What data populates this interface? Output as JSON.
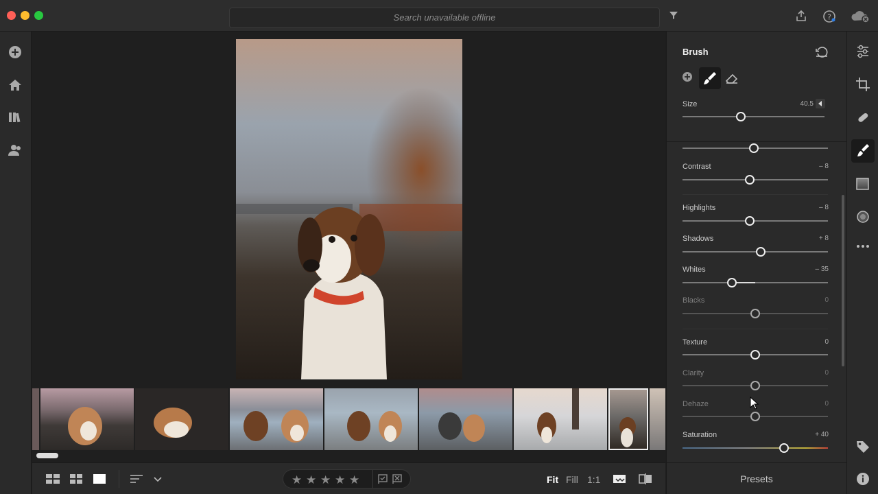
{
  "search": {
    "placeholder": "Search unavailable offline"
  },
  "panel": {
    "title": "Brush",
    "size": {
      "label": "Size",
      "value": "40.5",
      "level": 0.41
    },
    "sliders": [
      {
        "label": "",
        "value": "",
        "level": 0.49,
        "dim": false
      },
      {
        "label": "Contrast",
        "value": "– 8",
        "level": 0.46,
        "dim": false
      },
      {
        "label": "Highlights",
        "value": "– 8",
        "level": 0.46,
        "dim": false
      },
      {
        "label": "Shadows",
        "value": "+ 8",
        "level": 0.54,
        "dim": false
      },
      {
        "label": "Whites",
        "value": "– 35",
        "level": 0.34,
        "dim": false
      },
      {
        "label": "Blacks",
        "value": "0",
        "level": 0.5,
        "dim": true
      },
      {
        "label": "Texture",
        "value": "0",
        "level": 0.5,
        "dim": false
      },
      {
        "label": "Clarity",
        "value": "0",
        "level": 0.5,
        "dim": true
      },
      {
        "label": "Dehaze",
        "value": "0",
        "level": 0.5,
        "dim": true
      },
      {
        "label": "Saturation",
        "value": "+ 40",
        "level": 0.7,
        "dim": false
      }
    ]
  },
  "presets_label": "Presets",
  "zoom": {
    "fit": "Fit",
    "fill": "Fill",
    "one": "1:1"
  },
  "colors": {
    "accent": "#ffffff",
    "panel": "#2a2a2a",
    "canvas": "#1f1f1f"
  },
  "icons": {
    "titlebar": [
      "filter-icon",
      "share-icon",
      "help-icon",
      "cloud-offline-icon"
    ],
    "leftrail": [
      "add-photos-icon",
      "home-icon",
      "library-icon",
      "people-icon"
    ],
    "rightrail": [
      "edit-sliders-icon",
      "crop-icon",
      "healing-icon",
      "brush-icon",
      "linear-gradient-icon",
      "radial-gradient-icon",
      "more-icon",
      "tag-icon",
      "info-icon"
    ]
  },
  "filmstrip": {
    "count": 7,
    "selected": 7
  }
}
